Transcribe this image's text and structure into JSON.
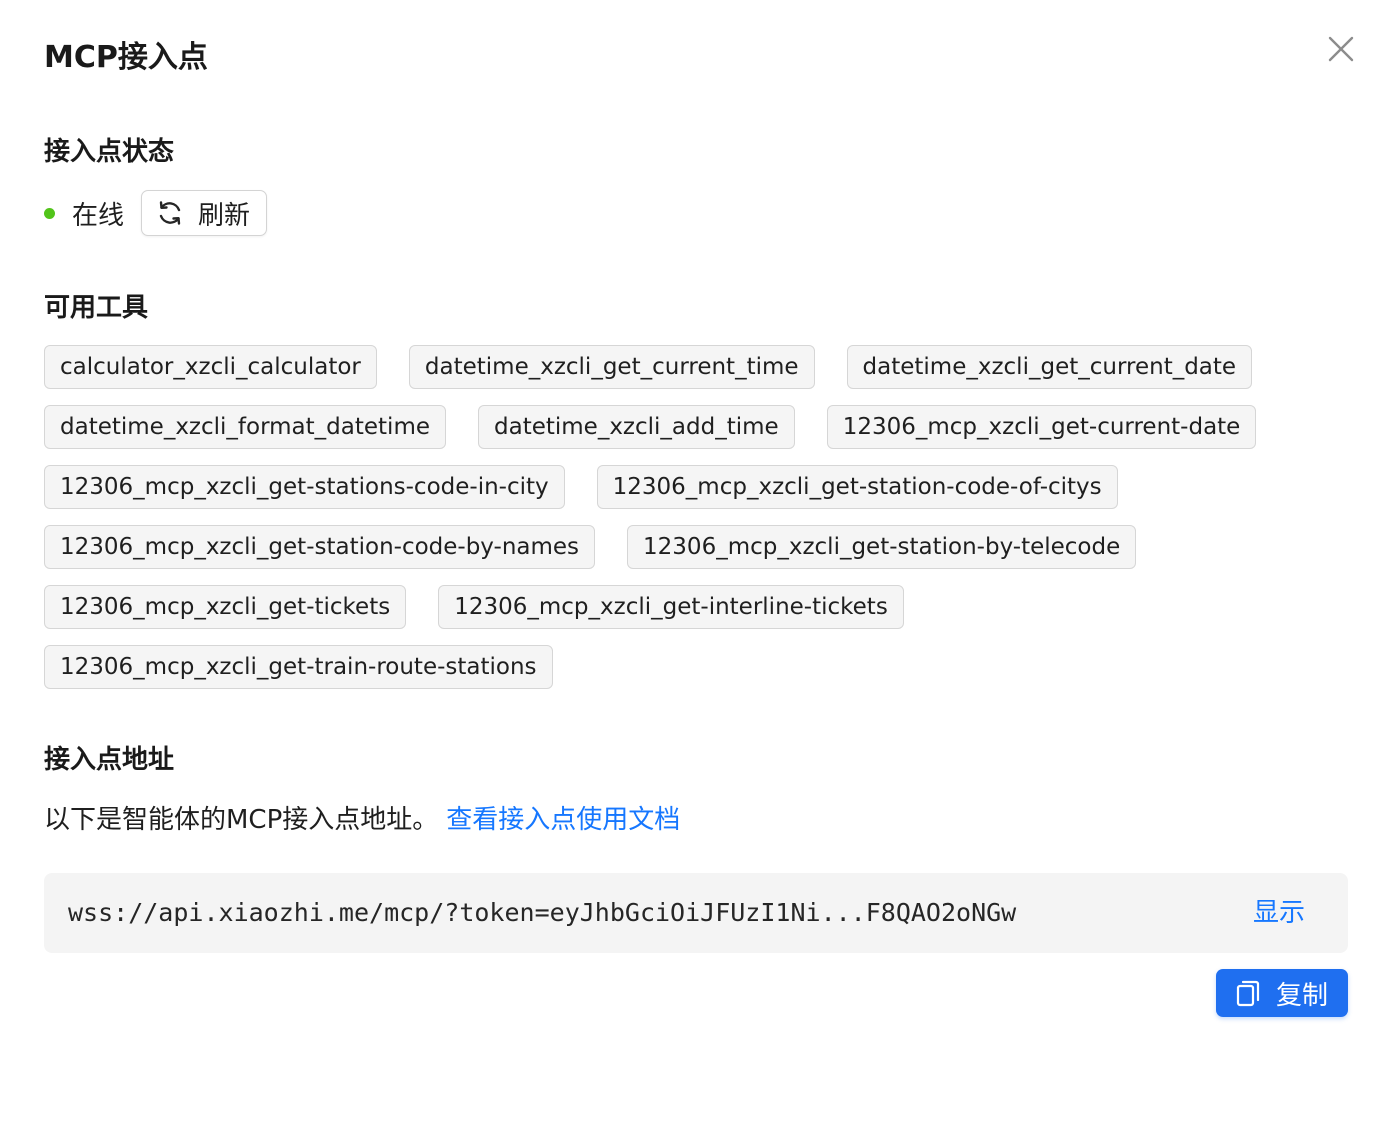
{
  "dialog": {
    "title": "MCP接入点",
    "close_icon": "close-icon"
  },
  "status_section": {
    "heading": "接入点状态",
    "status_text": "在线",
    "status_color": "#52c41a",
    "refresh_label": "刷新",
    "refresh_icon": "refresh-icon"
  },
  "tools_section": {
    "heading": "可用工具",
    "rows": [
      [
        "calculator_xzcli_calculator",
        "datetime_xzcli_get_current_time",
        "datetime_xzcli_get_current_date"
      ],
      [
        "datetime_xzcli_format_datetime",
        "datetime_xzcli_add_time",
        "12306_mcp_xzcli_get-current-date"
      ],
      [
        "12306_mcp_xzcli_get-stations-code-in-city",
        "12306_mcp_xzcli_get-station-code-of-citys"
      ],
      [
        "12306_mcp_xzcli_get-station-code-by-names",
        "12306_mcp_xzcli_get-station-by-telecode"
      ],
      [
        "12306_mcp_xzcli_get-tickets",
        "12306_mcp_xzcli_get-interline-tickets"
      ],
      [
        "12306_mcp_xzcli_get-train-route-stations"
      ]
    ]
  },
  "address_section": {
    "heading": "接入点地址",
    "description": "以下是智能体的MCP接入点地址。",
    "doc_link": "查看接入点使用文档",
    "url": "wss://api.xiaozhi.me/mcp/?token=eyJhbGciOiJFUzI1Ni...F8QAO2oNGw",
    "show_label": "显示",
    "copy_label": "复制",
    "copy_icon": "copy-icon",
    "accent_color": "#1677ff"
  }
}
